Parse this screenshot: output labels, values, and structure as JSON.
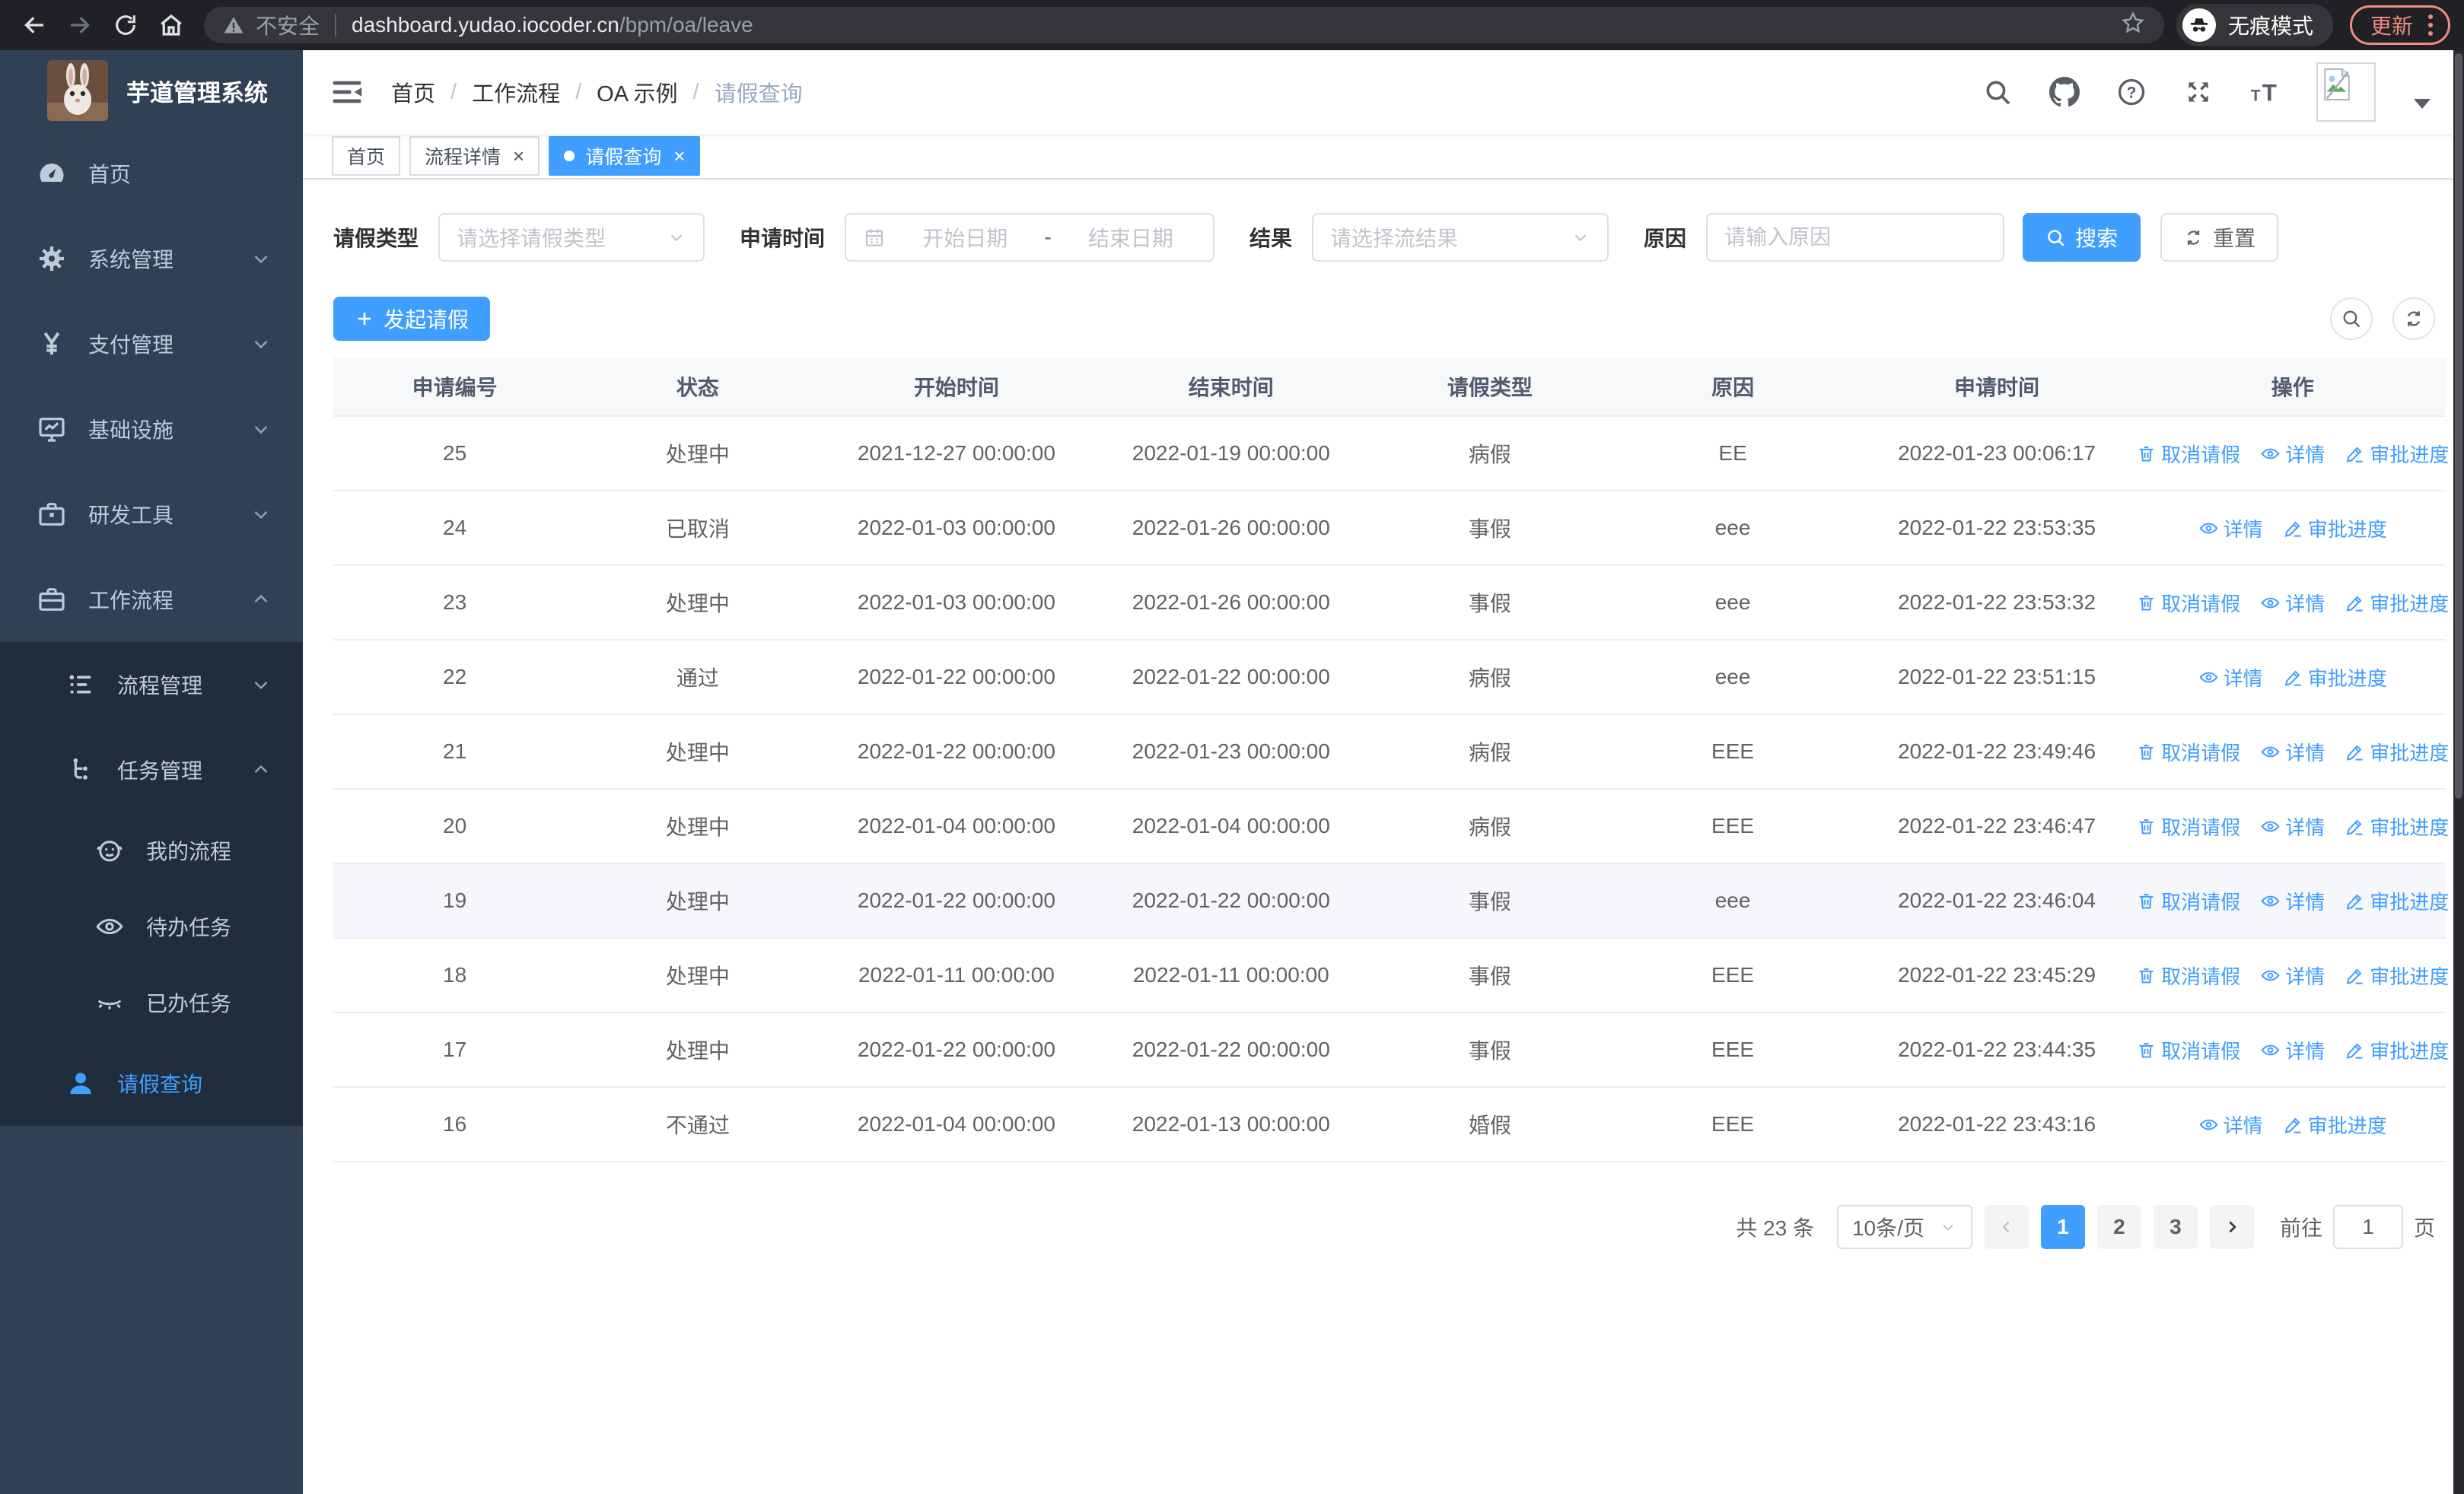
{
  "browser": {
    "security_label": "不安全",
    "url_host": "dashboard.yudao.iocoder.cn",
    "url_path": "/bpm/oa/leave",
    "incognito_label": "无痕模式",
    "update_label": "更新"
  },
  "sidebar": {
    "title": "芋道管理系统",
    "items": [
      {
        "label": "首页",
        "icon": "dashboard-icon"
      },
      {
        "label": "系统管理",
        "icon": "gear-icon"
      },
      {
        "label": "支付管理",
        "icon": "yen-icon"
      },
      {
        "label": "基础设施",
        "icon": "monitor-icon"
      },
      {
        "label": "研发工具",
        "icon": "toolbox-icon"
      },
      {
        "label": "工作流程",
        "icon": "briefcase-icon"
      },
      {
        "label": "流程管理",
        "icon": "list-icon"
      },
      {
        "label": "任务管理",
        "icon": "tree-icon"
      },
      {
        "label": "我的流程",
        "icon": "face-icon"
      },
      {
        "label": "待办任务",
        "icon": "eye-open-icon"
      },
      {
        "label": "已办任务",
        "icon": "eye-closed-icon"
      },
      {
        "label": "请假查询",
        "icon": "user-icon"
      }
    ]
  },
  "header": {
    "breadcrumb": [
      "首页",
      "工作流程",
      "OA 示例",
      "请假查询"
    ],
    "breadcrumb_separator": "/"
  },
  "tabs": [
    {
      "label": "首页"
    },
    {
      "label": "流程详情",
      "close": "×"
    },
    {
      "label": "请假查询",
      "close": "×",
      "active": true
    }
  ],
  "filters": {
    "leave_type_label": "请假类型",
    "leave_type_placeholder": "请选择请假类型",
    "apply_time_label": "申请时间",
    "start_date_placeholder": "开始日期",
    "date_separator": "-",
    "end_date_placeholder": "结束日期",
    "result_label": "结果",
    "result_placeholder": "请选择流结果",
    "reason_label": "原因",
    "reason_placeholder": "请输入原因",
    "search_label": "搜索",
    "reset_label": "重置"
  },
  "toolbar": {
    "create_label": "发起请假"
  },
  "table": {
    "columns": [
      "申请编号",
      "状态",
      "开始时间",
      "结束时间",
      "请假类型",
      "原因",
      "申请时间",
      "操作"
    ],
    "action_labels": {
      "cancel": "取消请假",
      "detail": "详情",
      "progress": "审批进度"
    },
    "rows": [
      {
        "id": "25",
        "status": "处理中",
        "start_time": "2021-12-27 00:00:00",
        "end_time": "2022-01-19 00:00:00",
        "leave_type": "病假",
        "reason": "EE",
        "apply_time": "2022-01-23 00:06:17",
        "actions": [
          "cancel",
          "detail",
          "progress"
        ],
        "highlighted": false
      },
      {
        "id": "24",
        "status": "已取消",
        "start_time": "2022-01-03 00:00:00",
        "end_time": "2022-01-26 00:00:00",
        "leave_type": "事假",
        "reason": "eee",
        "apply_time": "2022-01-22 23:53:35",
        "actions": [
          "detail",
          "progress"
        ],
        "highlighted": false
      },
      {
        "id": "23",
        "status": "处理中",
        "start_time": "2022-01-03 00:00:00",
        "end_time": "2022-01-26 00:00:00",
        "leave_type": "事假",
        "reason": "eee",
        "apply_time": "2022-01-22 23:53:32",
        "actions": [
          "cancel",
          "detail",
          "progress"
        ],
        "highlighted": false
      },
      {
        "id": "22",
        "status": "通过",
        "start_time": "2022-01-22 00:00:00",
        "end_time": "2022-01-22 00:00:00",
        "leave_type": "病假",
        "reason": "eee",
        "apply_time": "2022-01-22 23:51:15",
        "actions": [
          "detail",
          "progress"
        ],
        "highlighted": false
      },
      {
        "id": "21",
        "status": "处理中",
        "start_time": "2022-01-22 00:00:00",
        "end_time": "2022-01-23 00:00:00",
        "leave_type": "病假",
        "reason": "EEE",
        "apply_time": "2022-01-22 23:49:46",
        "actions": [
          "cancel",
          "detail",
          "progress"
        ],
        "highlighted": false
      },
      {
        "id": "20",
        "status": "处理中",
        "start_time": "2022-01-04 00:00:00",
        "end_time": "2022-01-04 00:00:00",
        "leave_type": "病假",
        "reason": "EEE",
        "apply_time": "2022-01-22 23:46:47",
        "actions": [
          "cancel",
          "detail",
          "progress"
        ],
        "highlighted": false
      },
      {
        "id": "19",
        "status": "处理中",
        "start_time": "2022-01-22 00:00:00",
        "end_time": "2022-01-22 00:00:00",
        "leave_type": "事假",
        "reason": "eee",
        "apply_time": "2022-01-22 23:46:04",
        "actions": [
          "cancel",
          "detail",
          "progress"
        ],
        "highlighted": true
      },
      {
        "id": "18",
        "status": "处理中",
        "start_time": "2022-01-11 00:00:00",
        "end_time": "2022-01-11 00:00:00",
        "leave_type": "事假",
        "reason": "EEE",
        "apply_time": "2022-01-22 23:45:29",
        "actions": [
          "cancel",
          "detail",
          "progress"
        ],
        "highlighted": false
      },
      {
        "id": "17",
        "status": "处理中",
        "start_time": "2022-01-22 00:00:00",
        "end_time": "2022-01-22 00:00:00",
        "leave_type": "事假",
        "reason": "EEE",
        "apply_time": "2022-01-22 23:44:35",
        "actions": [
          "cancel",
          "detail",
          "progress"
        ],
        "highlighted": false
      },
      {
        "id": "16",
        "status": "不通过",
        "start_time": "2022-01-04 00:00:00",
        "end_time": "2022-01-13 00:00:00",
        "leave_type": "婚假",
        "reason": "EEE",
        "apply_time": "2022-01-22 23:43:16",
        "actions": [
          "detail",
          "progress"
        ],
        "highlighted": false
      }
    ]
  },
  "pagination": {
    "total_label": "共 23 条",
    "page_size_label": "10条/页",
    "pages": [
      "1",
      "2",
      "3"
    ],
    "active_page": "1",
    "goto_label": "前往",
    "goto_value": "1",
    "goto_suffix": "页"
  }
}
